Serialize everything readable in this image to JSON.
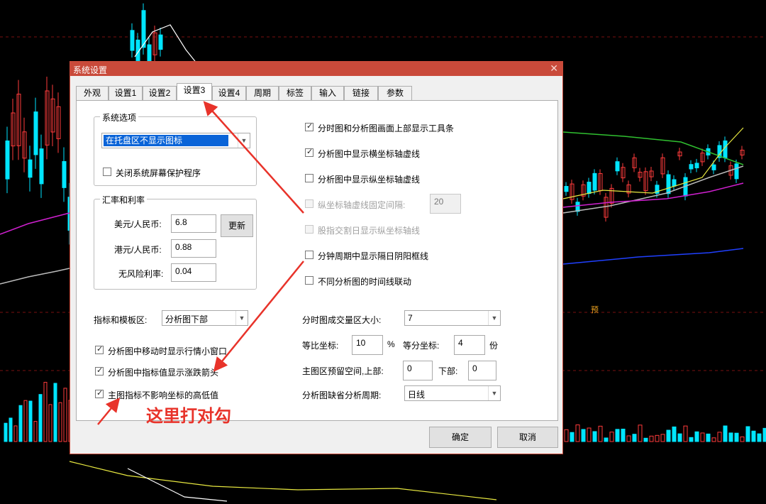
{
  "dialog": {
    "title": "系统设置",
    "close_symbol": "✕",
    "tabs": [
      "外观",
      "设置1",
      "设置2",
      "设置3",
      "设置4",
      "周期",
      "标签",
      "输入",
      "链接",
      "参数"
    ],
    "active_tab": "设置3",
    "system_options": {
      "title": "系统选项",
      "tray_select": "在托盘区不显示图标",
      "screensaver_label": "关闭系统屏幕保护程序",
      "screensaver_checked": false
    },
    "rates": {
      "title": "汇率和利率",
      "usd_label": "美元/人民币:",
      "usd_value": "6.8",
      "update_button": "更新",
      "hkd_label": "港元/人民币:",
      "hkd_value": "0.88",
      "riskfree_label": "无风险利率:",
      "riskfree_value": "0.04"
    },
    "template": {
      "label": "指标和模板区:",
      "value": "分析图下部"
    },
    "left_checks": [
      {
        "label": "分析图中移动时显示行情小窗口",
        "checked": true
      },
      {
        "label": "分析图中指标值显示涨跌箭头",
        "checked": true
      },
      {
        "label": "主图指标不影响坐标的高低值",
        "checked": true
      }
    ],
    "right_checks": [
      {
        "label": "分时图和分析图画面上部显示工具条",
        "checked": true
      },
      {
        "label": "分析图中显示横坐标轴虚线",
        "checked": true
      },
      {
        "label": "分析图中显示纵坐标轴虚线",
        "checked": false
      },
      {
        "label": "纵坐标轴虚线固定间隔:",
        "checked": false,
        "disabled": true
      },
      {
        "label": "股指交割日显示纵坐标轴线",
        "checked": false,
        "disabled": true
      },
      {
        "label": "分钟周期中显示隔日阴阳框线",
        "checked": false
      },
      {
        "label": "不同分析图的时间线联动",
        "checked": false
      }
    ],
    "interval_value": "20",
    "volume_label": "分时图成交量区大小:",
    "volume_value": "7",
    "ratio_label": "等比坐标:",
    "ratio_value": "10",
    "ratio_unit": "%",
    "equal_label": "等分坐标:",
    "equal_value": "4",
    "equal_unit": "份",
    "reserve_label": "主图区预留空间,上部:",
    "reserve_top": "0",
    "reserve_bottom_label": "下部:",
    "reserve_bottom": "0",
    "default_period_label": "分析图缺省分析周期:",
    "default_period_value": "日线",
    "ok_button": "确定",
    "cancel_button": "取消"
  },
  "annotation_text": "这里打对勾",
  "chart_marker": "预",
  "colors": {
    "title_bar": "#c94a3a",
    "annotation": "#e8332a",
    "up_candle": "#ff3b3b",
    "down_candle": "#00e5ff"
  }
}
